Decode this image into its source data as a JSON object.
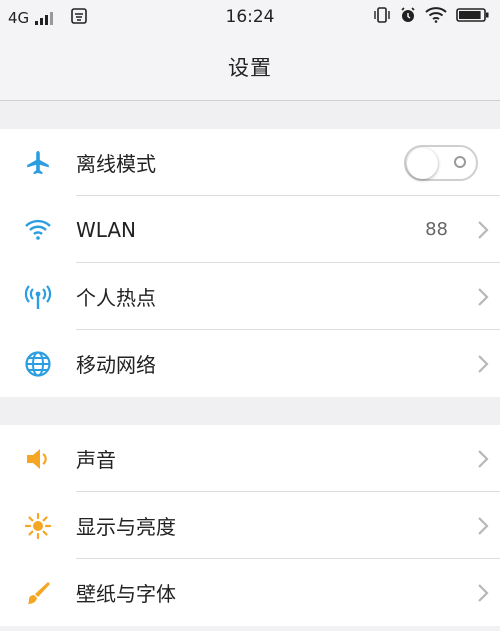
{
  "status_bar": {
    "network": "4G",
    "time": "16:24",
    "battery_level": 0.9,
    "icons": [
      "signal-icon",
      "notification-icon",
      "vibrate-icon",
      "alarm-icon",
      "wifi-icon",
      "battery-icon"
    ]
  },
  "header": {
    "title": "设置"
  },
  "sections": [
    {
      "items": [
        {
          "label": "离线模式",
          "icon": "airplane-icon",
          "control": "toggle",
          "toggle_on": false
        },
        {
          "label": "WLAN",
          "icon": "wifi-icon",
          "value": "88"
        },
        {
          "label": "个人热点",
          "icon": "hotspot-icon"
        },
        {
          "label": "移动网络",
          "icon": "globe-icon"
        }
      ]
    },
    {
      "items": [
        {
          "label": "声音",
          "icon": "speaker-icon"
        },
        {
          "label": "显示与亮度",
          "icon": "brightness-icon"
        },
        {
          "label": "壁纸与字体",
          "icon": "brush-icon"
        }
      ]
    }
  ],
  "colors": {
    "blue_icon": "#2a9ee0",
    "orange_icon": "#f5a623",
    "chevron": "#b7b7bb",
    "background": "#f0eff1"
  }
}
